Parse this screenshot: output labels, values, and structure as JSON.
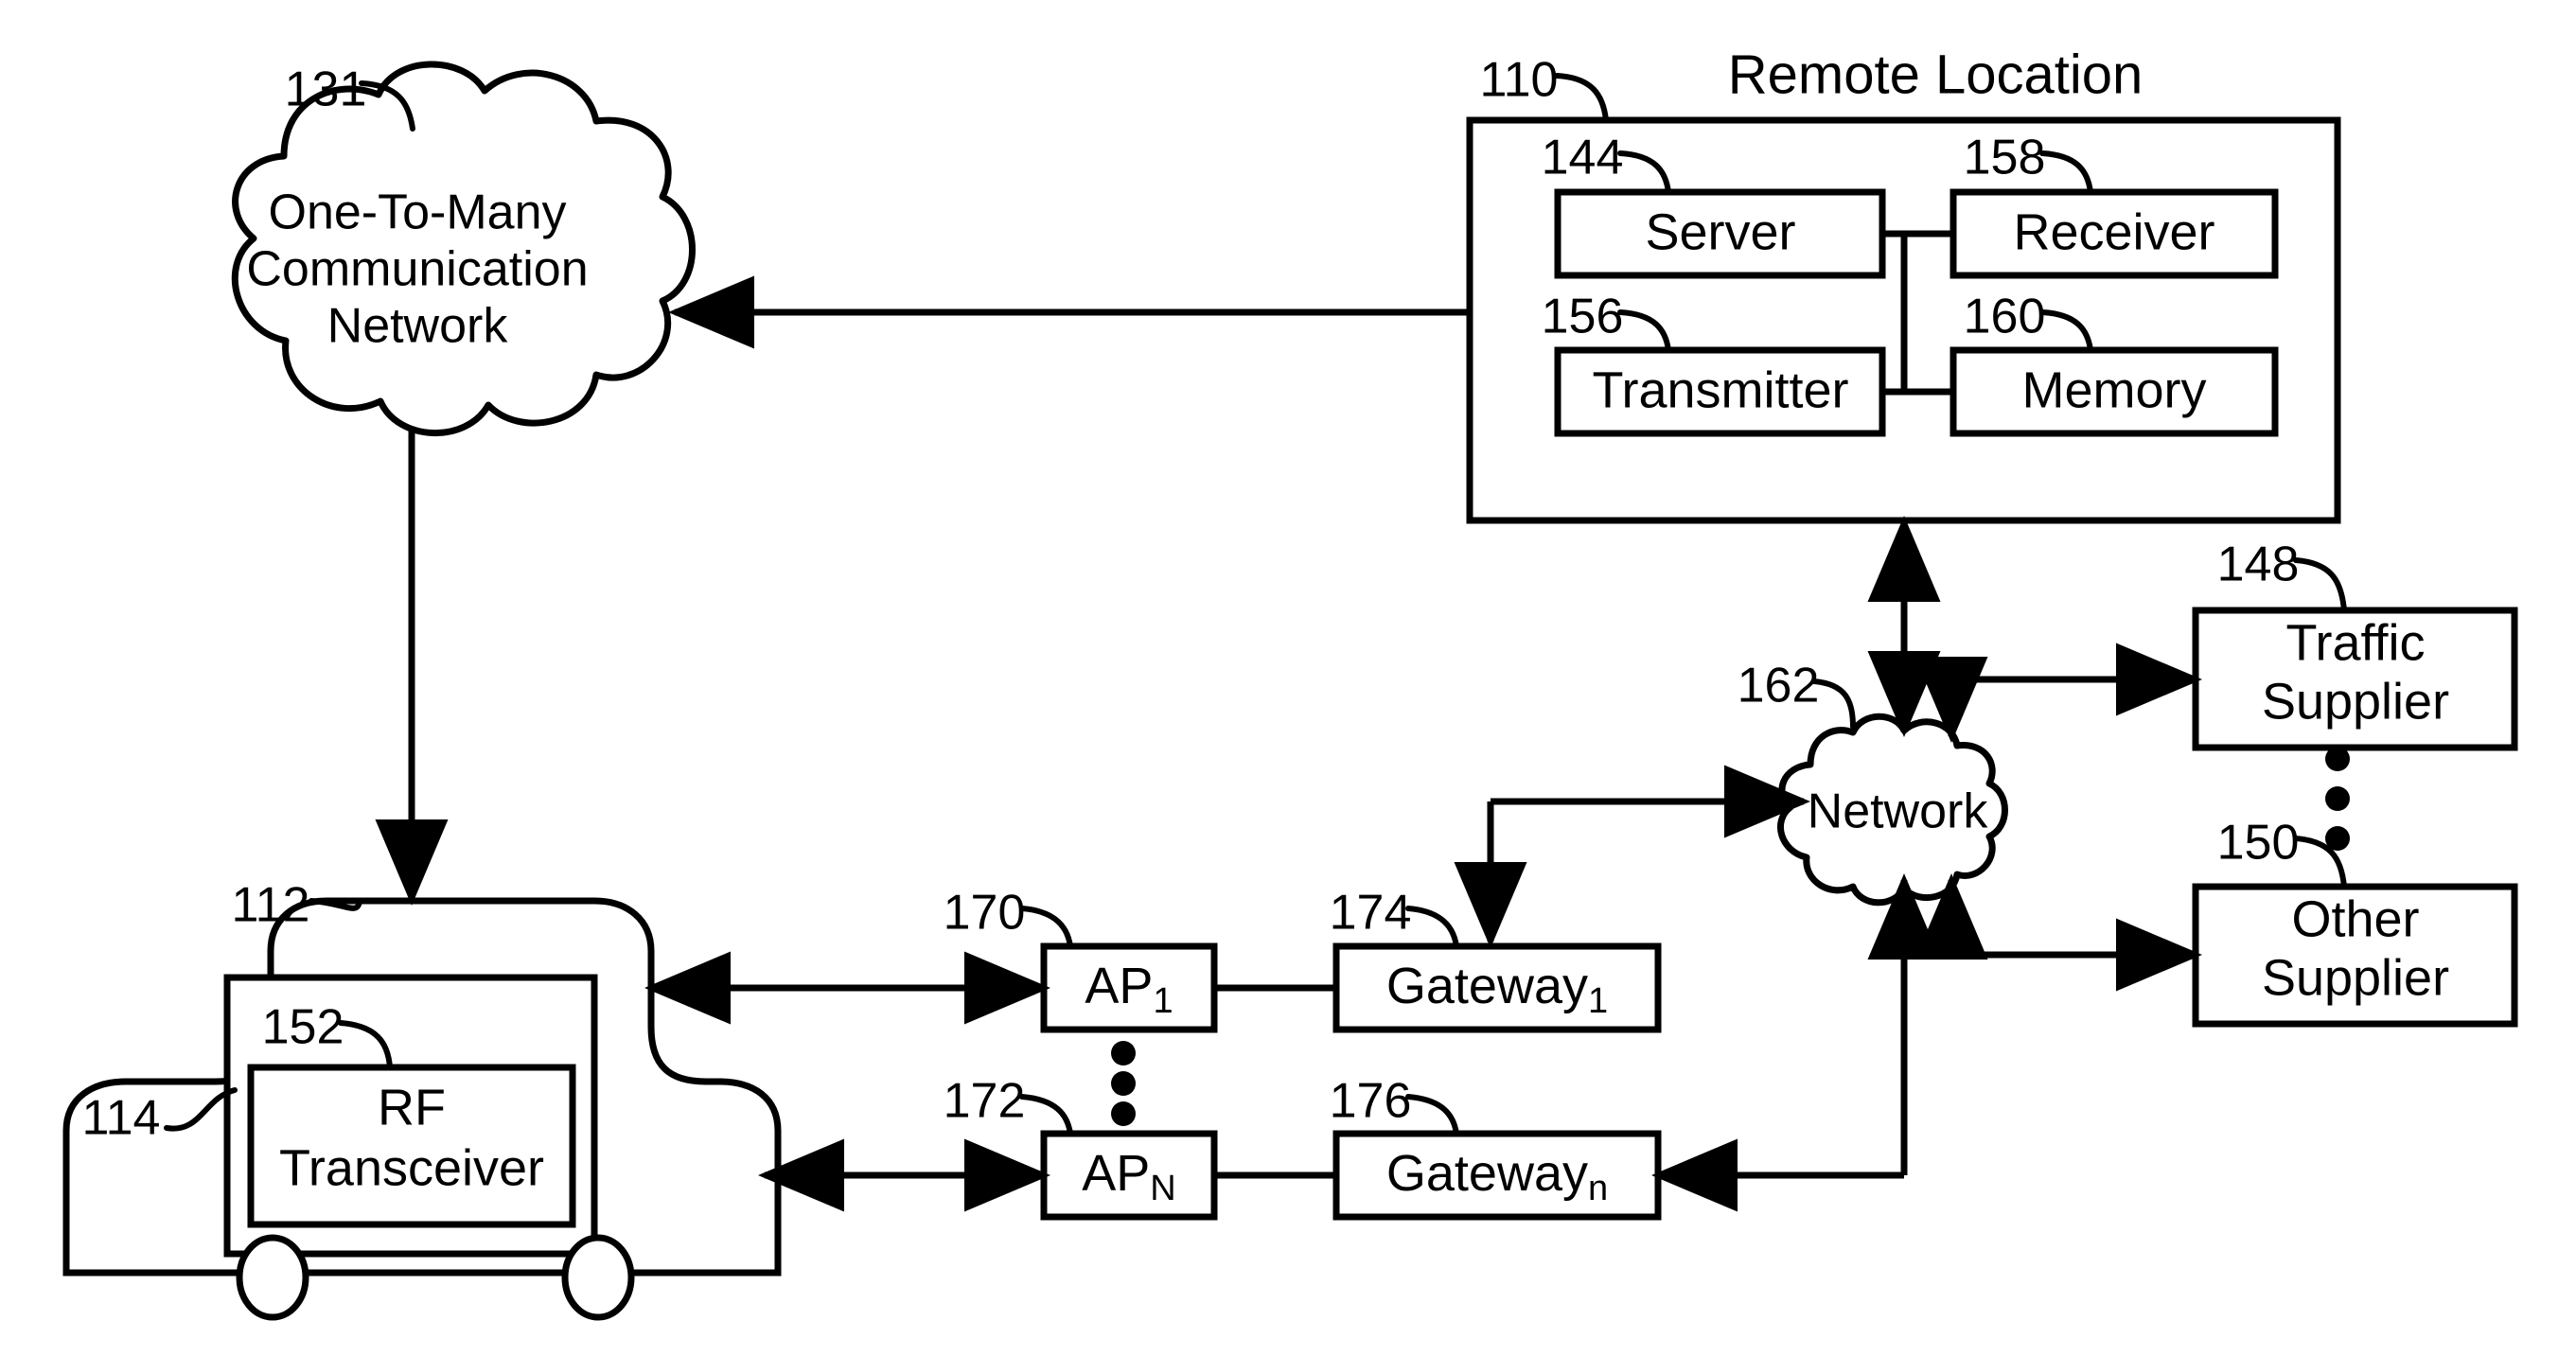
{
  "figure": {
    "title": "Remote Location",
    "type": "patent-block-diagram"
  },
  "clouds": {
    "one_to_many": {
      "ref": "131",
      "line1": "One-To-Many",
      "line2": "Communication",
      "line3": "Network"
    },
    "network": {
      "ref": "162",
      "label": "Network"
    }
  },
  "remote_location": {
    "ref": "110",
    "title": "Remote Location",
    "blocks": [
      {
        "ref": "144",
        "label": "Server"
      },
      {
        "ref": "158",
        "label": "Receiver"
      },
      {
        "ref": "156",
        "label": "Transmitter"
      },
      {
        "ref": "160",
        "label": "Memory"
      }
    ]
  },
  "suppliers": [
    {
      "ref": "148",
      "line1": "Traffic",
      "line2": "Supplier"
    },
    {
      "ref": "150",
      "line1": "Other",
      "line2": "Supplier"
    }
  ],
  "vehicle": {
    "ref_body": "112",
    "ref_inner": "114",
    "ref_transceiver": "152",
    "transceiver_line1": "RF",
    "transceiver_line2": "Transceiver"
  },
  "access_points": [
    {
      "ref": "170",
      "base": "AP",
      "sub": "1"
    },
    {
      "ref": "172",
      "base": "AP",
      "sub": "N"
    }
  ],
  "gateways": [
    {
      "ref": "174",
      "base": "Gateway",
      "sub": "1"
    },
    {
      "ref": "176",
      "base": "Gateway",
      "sub": "n"
    }
  ],
  "ellipsis": {
    "ap_column": "vertical-three-dots",
    "supplier_column": "vertical-three-dots"
  }
}
